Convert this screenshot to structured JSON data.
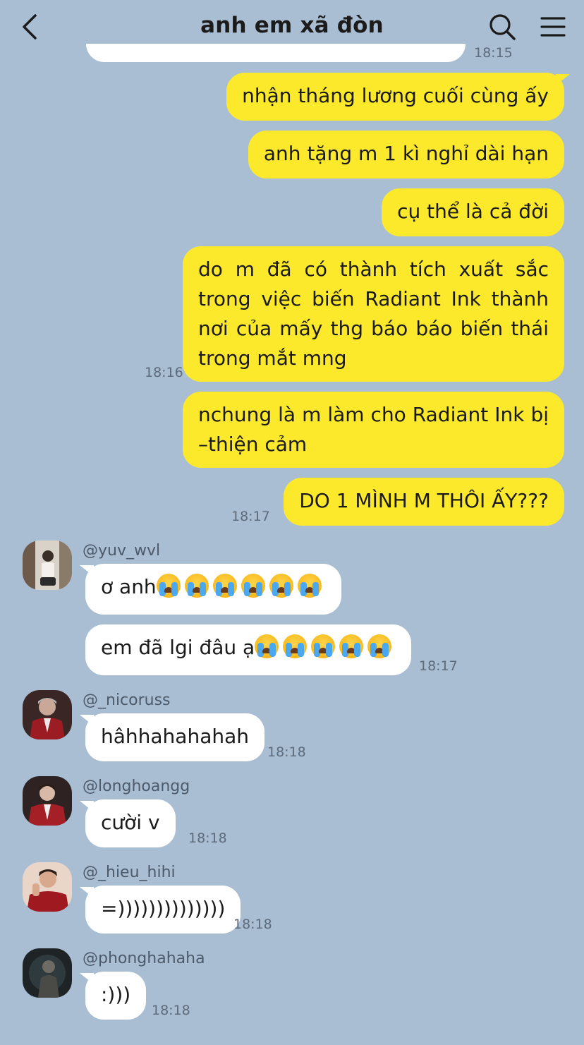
{
  "header": {
    "title": "anh em xã đòn"
  },
  "colors": {
    "background": "#aabed3",
    "my_bubble": "#fde92c",
    "other_bubble": "#ffffff"
  },
  "icons": [
    "back-chevron-icon",
    "search-icon",
    "menu-icon",
    "crying-face-emoji"
  ],
  "messages": {
    "m0_time": "18:15",
    "m1": "nhận tháng lương cuối cùng ấy",
    "m2": "anh tặng m 1 kì nghỉ dài hạn",
    "m3": "cụ thể là cả đời",
    "m4": "do m đã có thành tích xuất sắc trong việc biến Radiant Ink thành nơi của mấy thg báo báo biến thái trong mắt mng",
    "m4_time": "18:16",
    "m5": "nchung là m làm cho Radiant Ink bị –thiện cảm",
    "m6": "DO 1 MÌNH M THÔI ẤY???",
    "m6_time": "18:17"
  },
  "yuv": {
    "username": "@yuv_wvl",
    "msg1": "ơ anh",
    "msg2": "em đã lgi đâu ạ",
    "time": "18:17"
  },
  "nico": {
    "username": "@_nicoruss",
    "msg": "hâhhahahahah",
    "time": "18:18"
  },
  "long": {
    "username": "@longhoangg",
    "msg": "cười v",
    "time": "18:18"
  },
  "hieu": {
    "username": "@_hieu_hihi",
    "msg": "=))))))))))))))",
    "time": "18:18"
  },
  "phong": {
    "username": "@phonghahaha",
    "msg": ":)))",
    "time": "18:18"
  }
}
